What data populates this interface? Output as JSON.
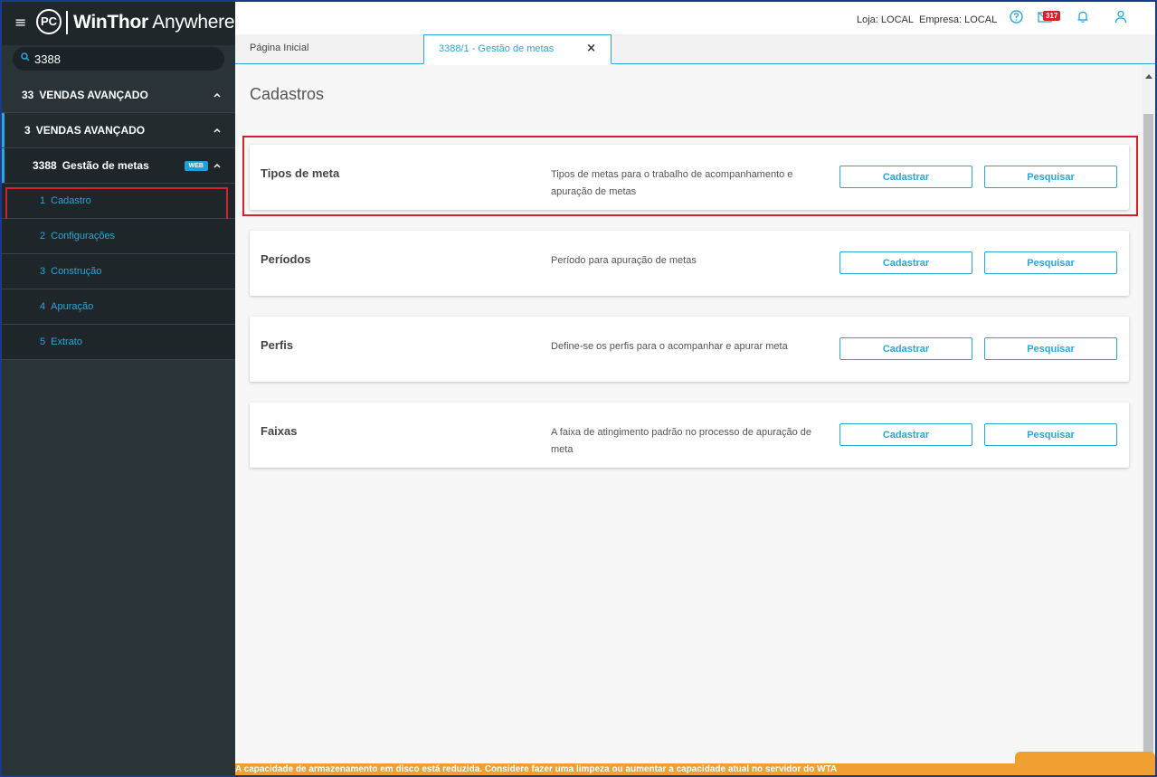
{
  "app": {
    "logo_mark": "PC",
    "logo_brand": "WinThor",
    "logo_suffix": "Anywhere"
  },
  "sidebar": {
    "search_value": "3388",
    "menu": [
      {
        "num": "33",
        "label": "VENDAS AVANÇADO"
      },
      {
        "num": "3",
        "label": "VENDAS AVANÇADO"
      },
      {
        "num": "3388",
        "label": "Gestão de metas",
        "badge": "WEB"
      }
    ],
    "subitems": [
      {
        "num": "1",
        "label": "Cadastro"
      },
      {
        "num": "2",
        "label": "Configurações"
      },
      {
        "num": "3",
        "label": "Construção"
      },
      {
        "num": "4",
        "label": "Apuração"
      },
      {
        "num": "5",
        "label": "Extrato"
      }
    ]
  },
  "header": {
    "loja": "Loja: LOCAL",
    "empresa": "Empresa: LOCAL",
    "mail_count": "317"
  },
  "tabs": [
    {
      "label": "Página Inicial"
    },
    {
      "label": "3388/1 - Gestão de metas",
      "close": "×"
    }
  ],
  "main": {
    "title": "Cadastros",
    "cards": [
      {
        "title": "Tipos de meta",
        "desc": "Tipos de metas para o trabalho de acompanhamento e apuração de metas",
        "btn_cadastrar": "Cadastrar",
        "btn_pesquisar": "Pesquisar"
      },
      {
        "title": "Períodos",
        "desc": "Período para apuração de metas",
        "btn_cadastrar": "Cadastrar",
        "btn_pesquisar": "Pesquisar"
      },
      {
        "title": "Perfis",
        "desc": "Define-se os perfis para o acompanhar e apurar meta",
        "btn_cadastrar": "Cadastrar",
        "btn_pesquisar": "Pesquisar"
      },
      {
        "title": "Faixas",
        "desc": "A faixa de atingimento padrão no processo de apuração de meta",
        "btn_cadastrar": "Cadastrar",
        "btn_pesquisar": "Pesquisar"
      }
    ]
  },
  "footer": {
    "warning": "A capacidade de armazenamento em disco está reduzida. Considere fazer uma limpeza ou aumentar a capacidade atual no servidor do WTA"
  },
  "colors": {
    "accent": "#2aa7d9",
    "highlight": "#d7202b",
    "sidebar": "#2a3337",
    "warning": "#f0a030"
  }
}
